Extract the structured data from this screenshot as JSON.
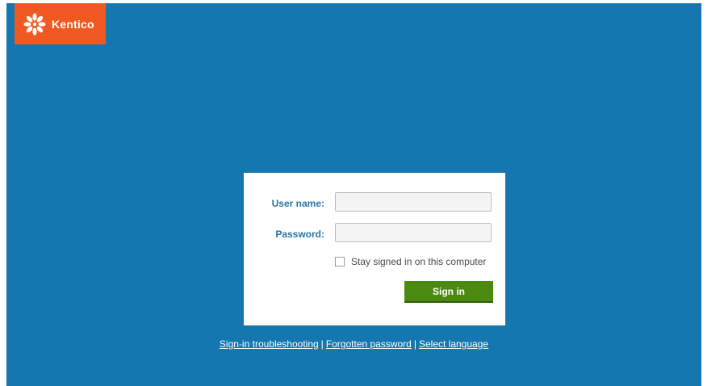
{
  "brand": {
    "name": "Kentico",
    "color": "#f05a22"
  },
  "colors": {
    "background": "#1477b0",
    "label": "#2a75a8",
    "button": "#4a8a11"
  },
  "form": {
    "username_label": "User name:",
    "username_value": "",
    "password_label": "Password:",
    "password_value": "",
    "stay_signed_in_label": "Stay signed in on this computer",
    "stay_signed_in_checked": false,
    "signin_label": "Sign in"
  },
  "links": {
    "troubleshooting": "Sign-in troubleshooting",
    "forgotten_password": "Forgotten password",
    "select_language": "Select language",
    "separator": "|"
  }
}
